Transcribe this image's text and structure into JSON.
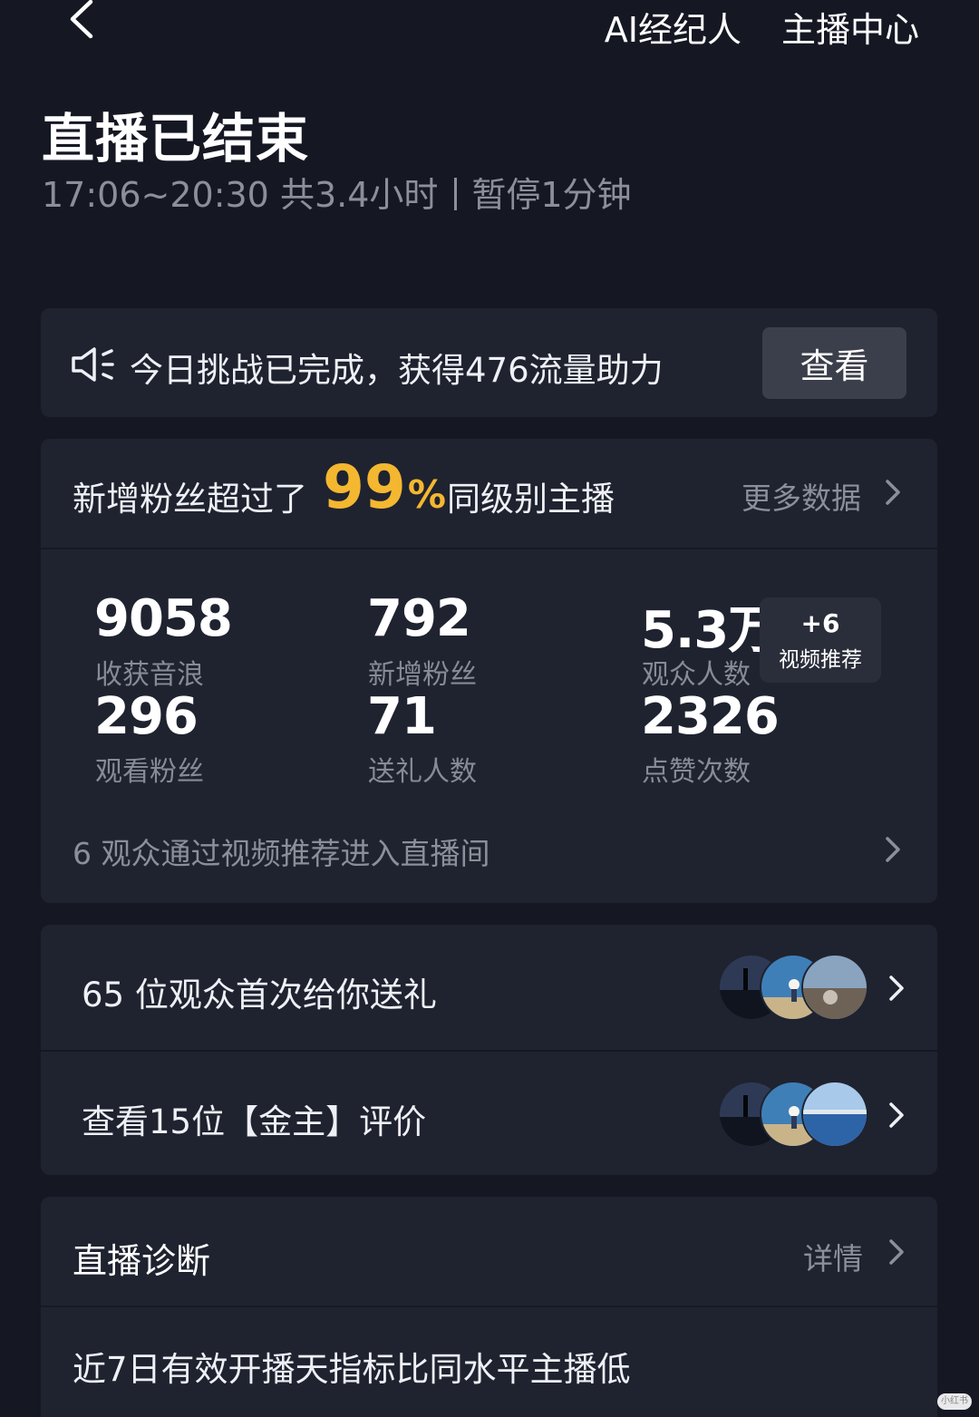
{
  "header": {
    "ai_agent_link": "AI经纪人",
    "anchor_center_link": "主播中心"
  },
  "page": {
    "title": "直播已结束",
    "time_range": "17:06~20:30 共3.4小时",
    "pause_info": "暂停1分钟"
  },
  "challenge": {
    "text": "今日挑战已完成，获得476流量助力",
    "button_label": "查看"
  },
  "fans_rank": {
    "prefix": "新增粉丝超过了",
    "percent": "99",
    "percent_sign": "%",
    "suffix": "同级别主播",
    "more_label": "更多数据"
  },
  "stats": [
    {
      "value": "9058",
      "label": "收获音浪"
    },
    {
      "value": "792",
      "label": "新增粉丝"
    },
    {
      "value": "5.3万",
      "label": "观众人数"
    },
    {
      "value": "296",
      "label": "观看粉丝"
    },
    {
      "value": "71",
      "label": "送礼人数"
    },
    {
      "value": "2326",
      "label": "点赞次数"
    }
  ],
  "video_badge": {
    "count": "+6",
    "label": "视频推荐"
  },
  "video_recommend_text": "6 观众通过视频推荐进入直播间",
  "gifts_row": {
    "text": "65 位观众首次给你送礼"
  },
  "reviews_row": {
    "text": "查看15位【金主】评价"
  },
  "diagnosis": {
    "title": "直播诊断",
    "details_label": "详情",
    "text": "近7日有效开播天指标比同水平主播低"
  },
  "watermark": "小红书",
  "colors": {
    "background": "#151823",
    "card": "#1f2330",
    "accent_yellow": "#f4b730",
    "muted_text": "#8b8f99"
  }
}
